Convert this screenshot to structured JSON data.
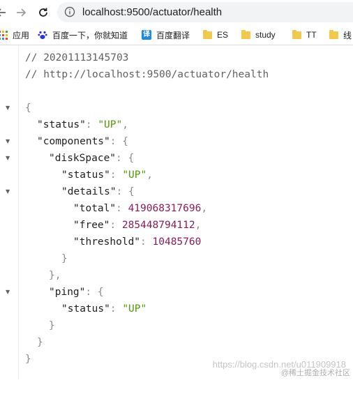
{
  "toolbar": {
    "url": "localhost:9500/actuator/health"
  },
  "bookmarks": [
    {
      "label": "应用",
      "icon": "apps-icon"
    },
    {
      "label": "百度一下，你就知道",
      "icon": "baidu-paw-icon"
    },
    {
      "label": "百度翻译",
      "icon": "baidu-translate-icon"
    },
    {
      "label": "ES",
      "icon": "folder-icon"
    },
    {
      "label": "study",
      "icon": "folder-icon"
    },
    {
      "label": "TT",
      "icon": "folder-icon"
    },
    {
      "label": "线",
      "icon": "folder-icon"
    }
  ],
  "json_view": {
    "comment_timestamp": "// 20201113145703",
    "comment_url": "// http://localhost:9500/actuator/health",
    "k_status": "\"status\"",
    "v_up": "\"UP\"",
    "k_components": "\"components\"",
    "k_diskspace": "\"diskSpace\"",
    "k_details": "\"details\"",
    "k_total": "\"total\"",
    "v_total": "419068317696",
    "k_free": "\"free\"",
    "v_free": "285448794112",
    "k_threshold": "\"threshold\"",
    "v_threshold": "10485760",
    "k_ping": "\"ping\""
  },
  "watermark": {
    "csdn": "https://blog.csdn.net/u011909918",
    "juejin": "@稀土掘金技术社区"
  },
  "colors": {
    "string": "#4e9a06",
    "number": "#8a1a5a",
    "comment": "#616161"
  }
}
